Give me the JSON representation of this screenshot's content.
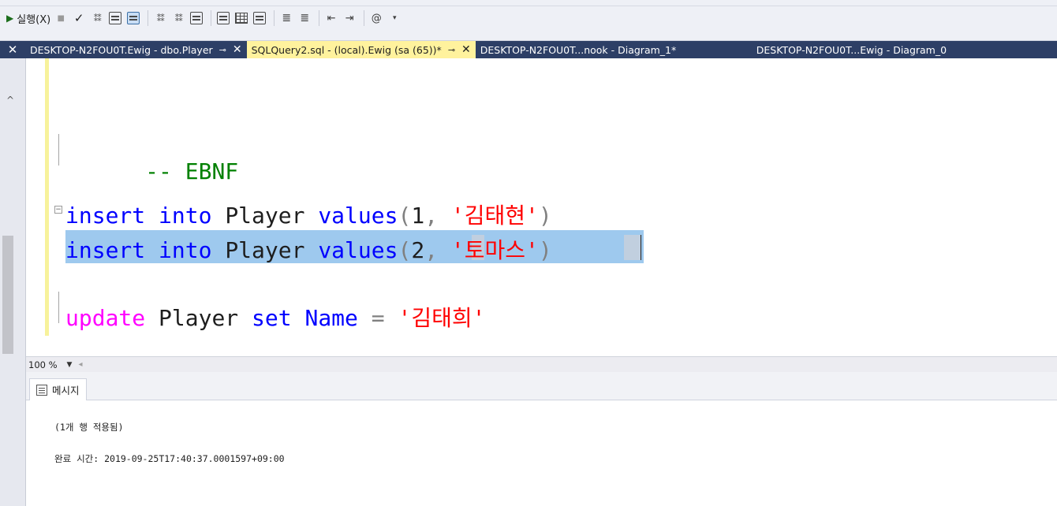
{
  "toolbar": {
    "execute_label": "실행(X)"
  },
  "tabs": [
    {
      "label": "DESKTOP-N2FOU0T.Ewig - dbo.Player",
      "pinned": true,
      "active": false
    },
    {
      "label": "SQLQuery2.sql - (local).Ewig (sa (65))*",
      "pinned": true,
      "active": true
    },
    {
      "label": "DESKTOP-N2FOU0T...nook - Diagram_1*",
      "active": false
    },
    {
      "label": "DESKTOP-N2FOU0T...Ewig - Diagram_0",
      "active": false
    }
  ],
  "editor": {
    "comment_line": "-- EBNF",
    "line1": {
      "kw1": "insert",
      "kw2": "into",
      "table": "Player",
      "kw3": "values",
      "open": "(",
      "num": "1",
      "comma": ",",
      "str": "'김태현'",
      "close": ")"
    },
    "line2": {
      "kw1": "insert",
      "kw2": "into",
      "table": "Player",
      "kw3": "values",
      "open": "(",
      "num": "2",
      "comma": ",",
      "str": "'토마스'",
      "close": ")"
    },
    "line3": {
      "kw1": "update",
      "table": "Player",
      "kw2": "set",
      "col": "Name",
      "eq": "=",
      "str": "'김태희'"
    }
  },
  "zoom": {
    "value": "100 %"
  },
  "results": {
    "tab_label": "메시지",
    "line1": "(1개 행 적용됨)",
    "line2": "완료 시간: 2019-09-25T17:40:37.0001597+09:00"
  },
  "colors": {
    "keyword": "#0000ff",
    "function": "#ff00ff",
    "string": "#ff0000",
    "comment": "#008000",
    "selection": "#9ec9ee",
    "active_tab": "#fff29d",
    "tabbar": "#2d3f66"
  }
}
